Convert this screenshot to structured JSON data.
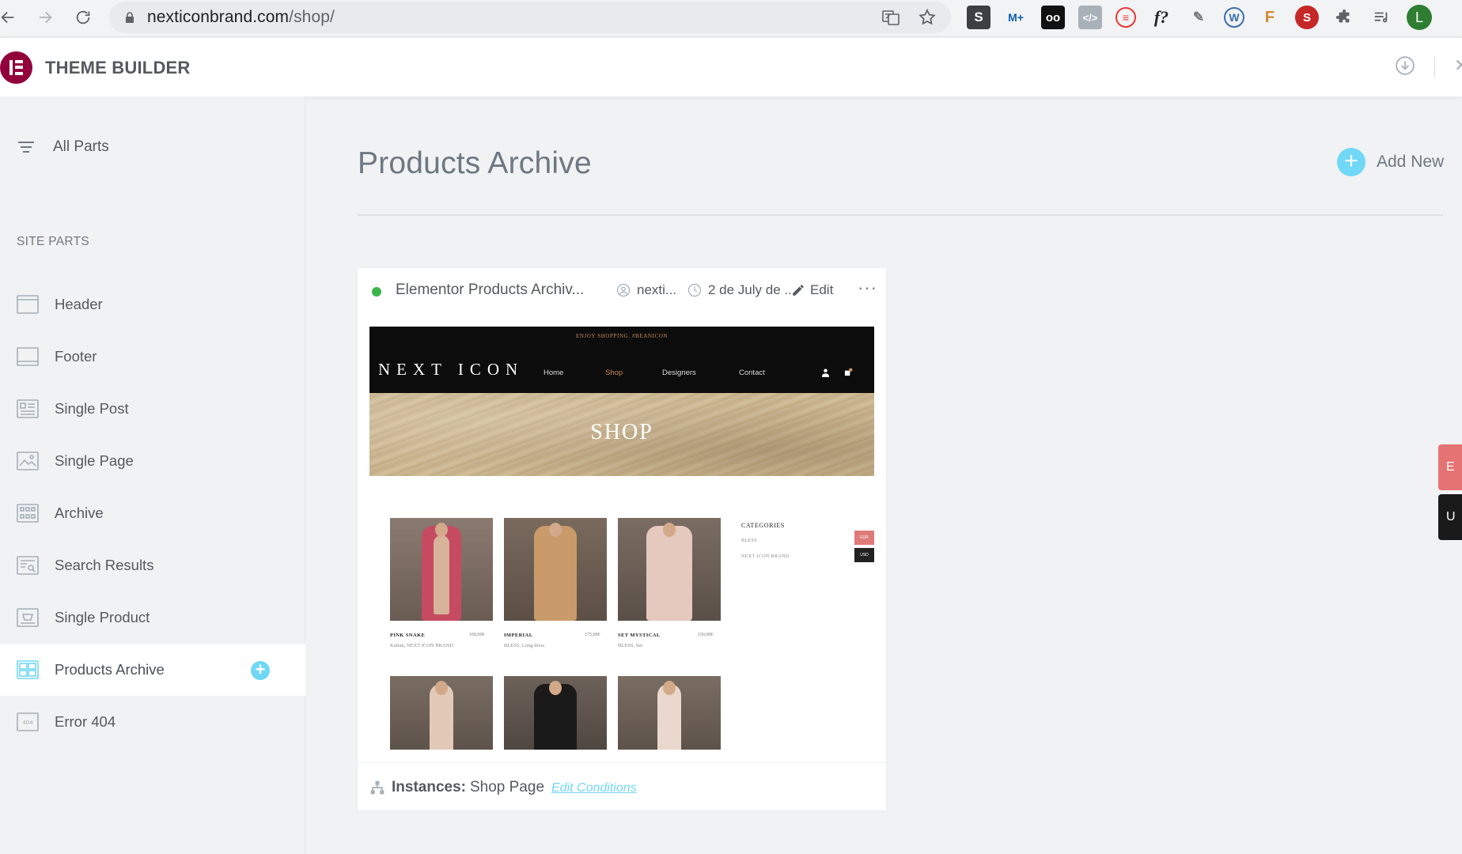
{
  "browser": {
    "url_domain": "nexticonbrand.com",
    "url_path": "/shop/",
    "profile_initial": "L",
    "extensions": [
      "S",
      "M+",
      "oo",
      "</>",
      "≡",
      "f?",
      "✎",
      "W",
      "F",
      "S",
      "puzzle",
      "list"
    ]
  },
  "header": {
    "title": "THEME BUILDER"
  },
  "sidebar": {
    "all_parts": "All Parts",
    "section_title": "SITE PARTS",
    "items": [
      {
        "label": "Header"
      },
      {
        "label": "Footer"
      },
      {
        "label": "Single Post"
      },
      {
        "label": "Single Page"
      },
      {
        "label": "Archive"
      },
      {
        "label": "Search Results"
      },
      {
        "label": "Single Product"
      },
      {
        "label": "Products Archive"
      },
      {
        "label": "Error 404"
      }
    ]
  },
  "main": {
    "title": "Products Archive",
    "add_new": "Add New"
  },
  "card": {
    "name": "Elementor Products Archiv...",
    "author": "nexti...",
    "date": "2 de July de ...",
    "edit": "Edit",
    "more": "···",
    "instances_label": "Instances:",
    "instances_value": "Shop Page",
    "edit_conditions": "Edit Conditions"
  },
  "preview": {
    "topbar": "ENJOY SHOPPING. #BEANICON",
    "logo": "NEXT ICON",
    "menu": [
      "Home",
      "Shop",
      "Designers",
      "Contact"
    ],
    "hero": "SHOP",
    "categories_title": "CATEGORIES",
    "categories": [
      "BLESS",
      "NEXT ICON BRAND"
    ],
    "currencies": [
      "EUR",
      "USD"
    ],
    "products": [
      {
        "name": "PINK SNAKE",
        "price": "160,00€",
        "sub": "Kaftan, NEXT ICON BRAND"
      },
      {
        "name": "IMPERIAL",
        "price": "175,00€",
        "sub": "BLESS, Long dress"
      },
      {
        "name": "SET MYSTICAL",
        "price": "150,00€",
        "sub": "BLESS, Set"
      }
    ]
  },
  "side_tabs": [
    "E",
    "U"
  ],
  "colors": {
    "accent": "#71d7f7",
    "brand": "#92003b",
    "status_active": "#39b54a"
  }
}
